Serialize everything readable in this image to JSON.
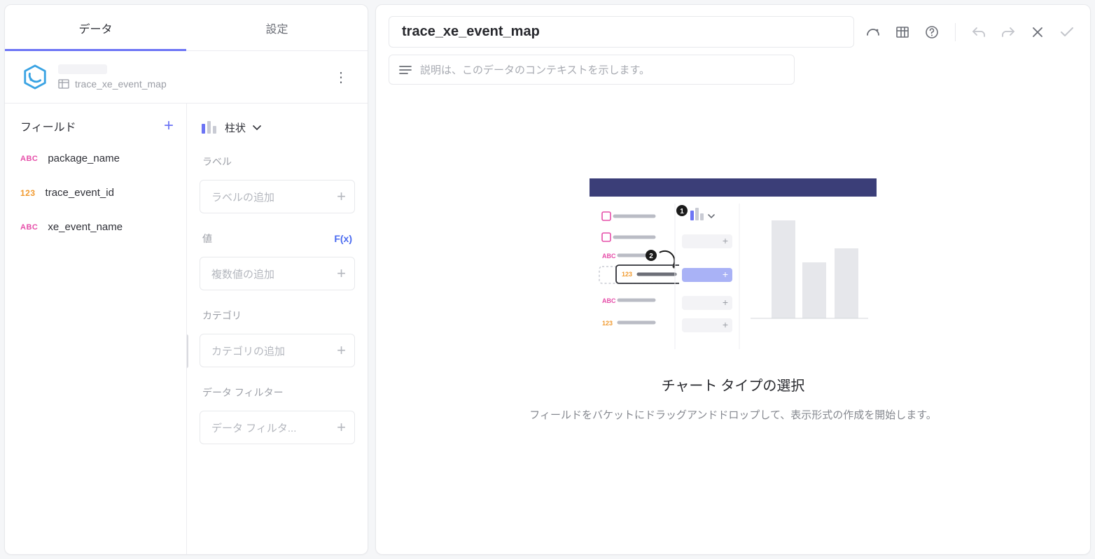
{
  "tabs": {
    "data": "データ",
    "settings": "設定"
  },
  "datasource": {
    "table": "trace_xe_event_map"
  },
  "fieldsHeader": "フィールド",
  "fields": [
    {
      "type": "ABC",
      "name": "package_name"
    },
    {
      "type": "123",
      "name": "trace_event_id"
    },
    {
      "type": "ABC",
      "name": "xe_event_name"
    }
  ],
  "chartType": "柱状",
  "sections": {
    "label": {
      "title": "ラベル",
      "placeholder": "ラベルの追加"
    },
    "value": {
      "title": "値",
      "placeholder": "複数値の追加",
      "fx": "F(x)"
    },
    "category": {
      "title": "カテゴリ",
      "placeholder": "カテゴリの追加"
    },
    "filter": {
      "title": "データ フィルター",
      "placeholder": "データ フィルタ..."
    }
  },
  "rp": {
    "title": "trace_xe_event_map",
    "descPlaceholder": "説明は、このデータのコンテキストを示します。"
  },
  "illus": {
    "title": "チャート タイプの選択",
    "sub": "フィールドをバケットにドラッグアンドドロップして、表示形式の作成を開始します。"
  }
}
